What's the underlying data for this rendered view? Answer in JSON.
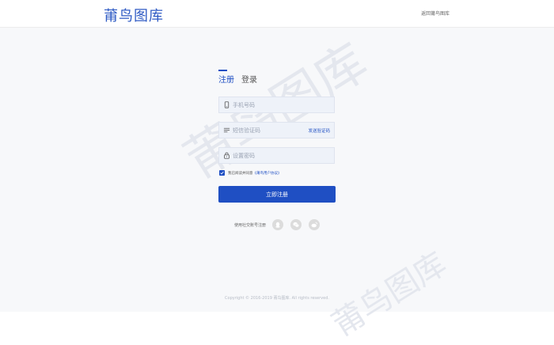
{
  "header": {
    "logo": "莆鸟图库",
    "back_home": "返回莆鸟图库"
  },
  "watermark": "莆鸟图库",
  "tabs": [
    {
      "label": "注册",
      "active": true
    },
    {
      "label": "登录",
      "active": false
    }
  ],
  "form": {
    "phone_placeholder": "手机号码",
    "code_placeholder": "短信验证码",
    "send_code": "发送验证码",
    "password_placeholder": "设置密码",
    "agree_checked": true,
    "agree_text": "我已阅读并同意",
    "agreement_link": "《莆鸟用户协议》",
    "submit": "立即注册"
  },
  "social": {
    "label": "使用社交账号注册",
    "providers": [
      "qq-icon",
      "wechat-icon",
      "weibo-icon"
    ]
  },
  "footer": "Copyright © 2016-2019 莆鸟图库. All rights reserved.",
  "colors": {
    "accent": "#1f4fc3",
    "input_bg": "#eef2f9"
  }
}
